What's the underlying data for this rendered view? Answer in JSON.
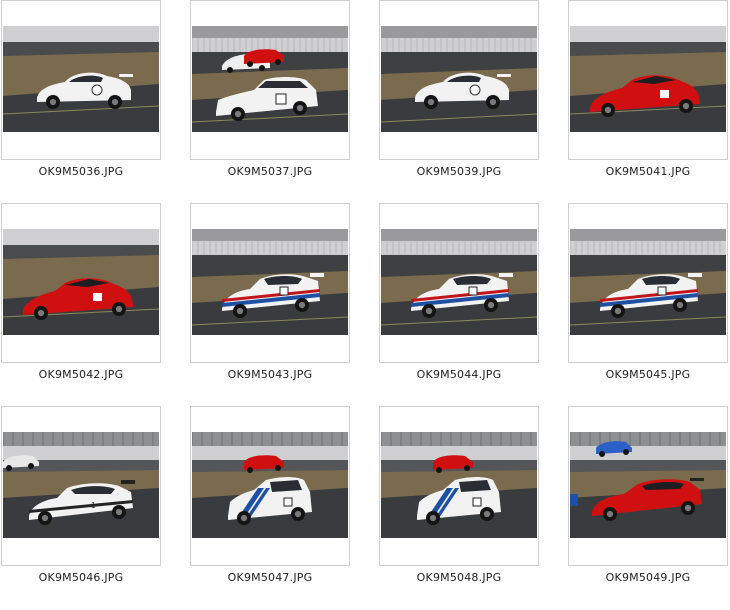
{
  "files": [
    {
      "filename": "OK9M5036.JPG",
      "scene": {
        "bg": "grass",
        "car": "white-porsche",
        "fg": []
      }
    },
    {
      "filename": "OK9M5037.JPG",
      "scene": {
        "bg": "grandstand",
        "car": "white-bmw",
        "fg": [
          "white-porsche-small",
          "red-car-small"
        ]
      }
    },
    {
      "filename": "OK9M5039.JPG",
      "scene": {
        "bg": "grandstand",
        "car": "white-porsche",
        "fg": []
      }
    },
    {
      "filename": "OK9M5041.JPG",
      "scene": {
        "bg": "grass",
        "car": "red-roadster",
        "fg": []
      }
    },
    {
      "filename": "OK9M5042.JPG",
      "scene": {
        "bg": "grass",
        "car": "red-roadster",
        "fg": []
      }
    },
    {
      "filename": "OK9M5043.JPG",
      "scene": {
        "bg": "grandstand",
        "car": "white-935-stripes",
        "fg": []
      }
    },
    {
      "filename": "OK9M5044.JPG",
      "scene": {
        "bg": "grandstand",
        "car": "white-935-stripes",
        "fg": []
      }
    },
    {
      "filename": "OK9M5045.JPG",
      "scene": {
        "bg": "grandstand",
        "car": "white-935-stripes",
        "fg": []
      }
    },
    {
      "filename": "OK9M5046.JPG",
      "scene": {
        "bg": "fence",
        "car": "white-gt3-stripes",
        "fg": [
          "white-car-small-left"
        ]
      }
    },
    {
      "filename": "OK9M5047.JPG",
      "scene": {
        "bg": "fence",
        "car": "white-hatch-stripes",
        "fg": [
          "red-car-small"
        ]
      }
    },
    {
      "filename": "OK9M5048.JPG",
      "scene": {
        "bg": "fence",
        "car": "white-hatch-stripes",
        "fg": [
          "red-car-small"
        ]
      }
    },
    {
      "filename": "OK9M5049.JPG",
      "scene": {
        "bg": "fence",
        "car": "red-ferrari",
        "fg": [
          "blue-car-small",
          "blue-edge-left"
        ]
      }
    }
  ],
  "colors": {
    "asphalt": "#3a3b3e",
    "grass": "#7a6a4e",
    "barrier": "#cfcfd1",
    "car_white": "#f2f2f2",
    "car_red": "#d01010",
    "stripe_blue": "#1d4fa3",
    "stripe_red": "#c3141a"
  }
}
